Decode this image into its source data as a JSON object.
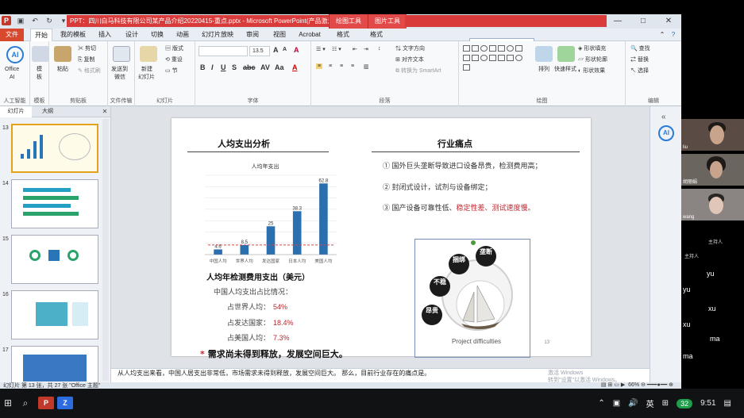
{
  "window": {
    "title": "PPT：四川白马科技有限公司某产品介绍20220415-重点.pptx - Microsoft PowerPoint(产品激活失败)",
    "context_tabs": [
      "绘图工具",
      "图片工具"
    ],
    "controls": [
      "—",
      "□",
      "✕"
    ]
  },
  "ribbon_tabs": [
    "文件",
    "开始",
    "我的模板",
    "插入",
    "设计",
    "切换",
    "动画",
    "幻灯片放映",
    "审阅",
    "视图",
    "Acrobat",
    "格式",
    "格式"
  ],
  "floatbar": [
    "英",
    "🌙",
    "⊞",
    "✿",
    "⚙"
  ],
  "ribbon": {
    "ai": {
      "logo": "AI",
      "label1": "Office",
      "label2": "AI",
      "group": "人工智能"
    },
    "template": {
      "label1": "模",
      "label2": "板",
      "group": "模板"
    },
    "clipboard": {
      "paste": "粘贴",
      "cut": "剪切",
      "copy": "复制",
      "painter": "格式刷",
      "group": "剪贴板"
    },
    "transfer": {
      "label1": "发送到",
      "label2": "微信",
      "group": "文件传输"
    },
    "slides": {
      "new1": "新建",
      "new2": "幻灯片",
      "layout": "版式",
      "reset": "重设",
      "section": "节",
      "group": "幻灯片"
    },
    "font": {
      "name": "",
      "size": "13.5",
      "group": "字体",
      "grow": "A",
      "shrink": "A",
      "clear": "A"
    },
    "paragraph": {
      "dir": "文字方向",
      "align": "对齐文本",
      "smartart": "转换为 SmartArt",
      "group": "段落"
    },
    "drawing": {
      "arrange": "排列",
      "quick": "快速样式",
      "fill": "形状填充",
      "outline": "形状轮廓",
      "effect": "形状效果",
      "group": "绘图"
    },
    "editing": {
      "find": "查找",
      "replace": "替换",
      "select": "选择",
      "group": "编辑"
    }
  },
  "left_panel": {
    "tabs": [
      "幻灯片",
      "大纲"
    ],
    "close": "✕",
    "thumbs": [
      {
        "num": "13"
      },
      {
        "num": "14"
      },
      {
        "num": "15"
      },
      {
        "num": "16"
      },
      {
        "num": "17"
      }
    ]
  },
  "slide": {
    "left_title": "人均支出分析",
    "right_title": "行业痛点",
    "annual_head": "人均年检测费用支出（美元）",
    "ratio_head": "中国人均支出占比情况：",
    "ratios": [
      {
        "label": "占世界人均：",
        "value": "54%"
      },
      {
        "label": "占发达国家：",
        "value": "18.4%"
      },
      {
        "label": "占美国人均：",
        "value": "7.3%"
      }
    ],
    "conclusion_star": "*",
    "conclusion": "需求尚未得到释放，发展空间巨大。",
    "pain_points": [
      {
        "text": "① 国外巨头垄断导致进口设备昂贵，检测费用高；",
        "hl": ""
      },
      {
        "text": "② 封闭式设计，试剂与设备绑定；",
        "hl": ""
      },
      {
        "text": "③ 国产设备可靠性低、",
        "hl": "稳定性差、测试速度慢。"
      }
    ],
    "diagram_nodes": [
      "垄断",
      "捆绑",
      "不稳",
      "昂贵"
    ],
    "diagram_label": "Project difficulties",
    "slide_number": "13"
  },
  "chart_data": {
    "type": "bar",
    "title": "人均年支出",
    "categories": [
      "中国人均",
      "世界人均",
      "发达国家",
      "日本人均",
      "美国人均"
    ],
    "values": [
      4.6,
      8.5,
      25,
      38.3,
      62.8
    ],
    "ylim": [
      0,
      70
    ],
    "color": "#2a6fb0",
    "grid": true
  },
  "notes": "从人均支出来看，中国人居支出非常低，市场需求未得到释放，发展空间巨大。\n那么，目前行业存在的痛点是。",
  "statusbar": {
    "left": "幻灯片 第 13 张，共 27 张    \"Office 主题\"",
    "zoom": "66%"
  },
  "watermark": [
    "激活 Windows",
    "转到\"设置\"以激活 Windows。"
  ],
  "video": {
    "names": [
      "liu",
      "胡丽娟",
      "wang"
    ],
    "host_label": "主持人",
    "host_label2": "主持人",
    "chat": [
      "yu",
      "yu",
      "xu",
      "xu",
      "ma",
      "ma"
    ]
  },
  "taskbar": {
    "time": "9:51",
    "lang": "英",
    "badge": "32"
  }
}
